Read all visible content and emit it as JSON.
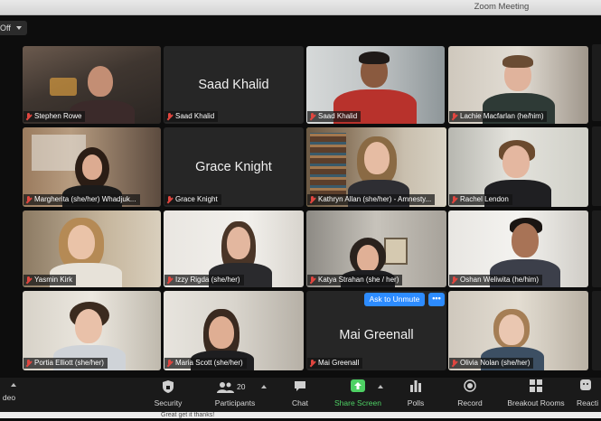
{
  "window": {
    "title": "Zoom Meeting"
  },
  "topbar": {
    "view_label": "Off"
  },
  "participants": [
    {
      "name": "Stephen Rowe",
      "label": "Stephen Rowe",
      "muted": true,
      "video": true
    },
    {
      "name": "Saad Khalid",
      "label": "Saad Khalid",
      "muted": true,
      "video": false
    },
    {
      "name": "Saad Khalid",
      "label": "Saad Khalid",
      "muted": true,
      "video": true
    },
    {
      "name": "Lachie Macfarlan (he/him)",
      "label": "Lachie Macfarlan (he/him)",
      "muted": true,
      "video": true
    },
    {
      "name": "Margherita (she/her) Whadjuk",
      "label": "Margherita (she/her) Whadjuk...",
      "muted": true,
      "video": true
    },
    {
      "name": "Grace Knight",
      "label": "Grace Knight",
      "muted": true,
      "video": false
    },
    {
      "name": "Kathryn Allan (she/her) - Amnesty",
      "label": "Kathryn Allan (she/her) - Amnesty...",
      "muted": false,
      "video": true,
      "active_speaker": true
    },
    {
      "name": "Rachel Lendon",
      "label": "Rachel Lendon",
      "muted": true,
      "video": true
    },
    {
      "name": "Yasmin Kirk",
      "label": "Yasmin Kirk",
      "muted": true,
      "video": true
    },
    {
      "name": "Izzy Rigda (she/her)",
      "label": "Izzy Rigda (she/her)",
      "muted": true,
      "video": true
    },
    {
      "name": "Katya Strahan (she / her)",
      "label": "Katya Strahan (she / her)",
      "muted": true,
      "video": true
    },
    {
      "name": "Oshan Weliwita (he/him)",
      "label": "Oshan Weliwita (he/him)",
      "muted": true,
      "video": true
    },
    {
      "name": "Portia Elliott (she/her)",
      "label": "Portia Elliott (she/her)",
      "muted": true,
      "video": true
    },
    {
      "name": "Maria Scott (she/her)",
      "label": "Maria Scott (she/her)",
      "muted": true,
      "video": true
    },
    {
      "name": "Mai Greenall",
      "label": "Mai Greenall",
      "muted": true,
      "video": false
    },
    {
      "name": "Olivia Nolan (she/her)",
      "label": "Olivia Nolan (she/her)",
      "muted": true,
      "video": true
    }
  ],
  "ask_to_unmute": {
    "label": "Ask to Unmute",
    "more": "•••"
  },
  "toolbar": {
    "video": "deo",
    "security": "Security",
    "participants": "Participants",
    "participants_count": "20",
    "chat": "Chat",
    "share_screen": "Share Screen",
    "polls": "Polls",
    "record": "Record",
    "breakout_rooms": "Breakout Rooms",
    "reactions": "Reacti"
  },
  "chat_snippet": "Great get it thanks!",
  "colors": {
    "share_green": "#4ed164",
    "ask_blue": "#2d8cff",
    "active_border": "#b7d45a",
    "muted_red": "#e0463f"
  }
}
